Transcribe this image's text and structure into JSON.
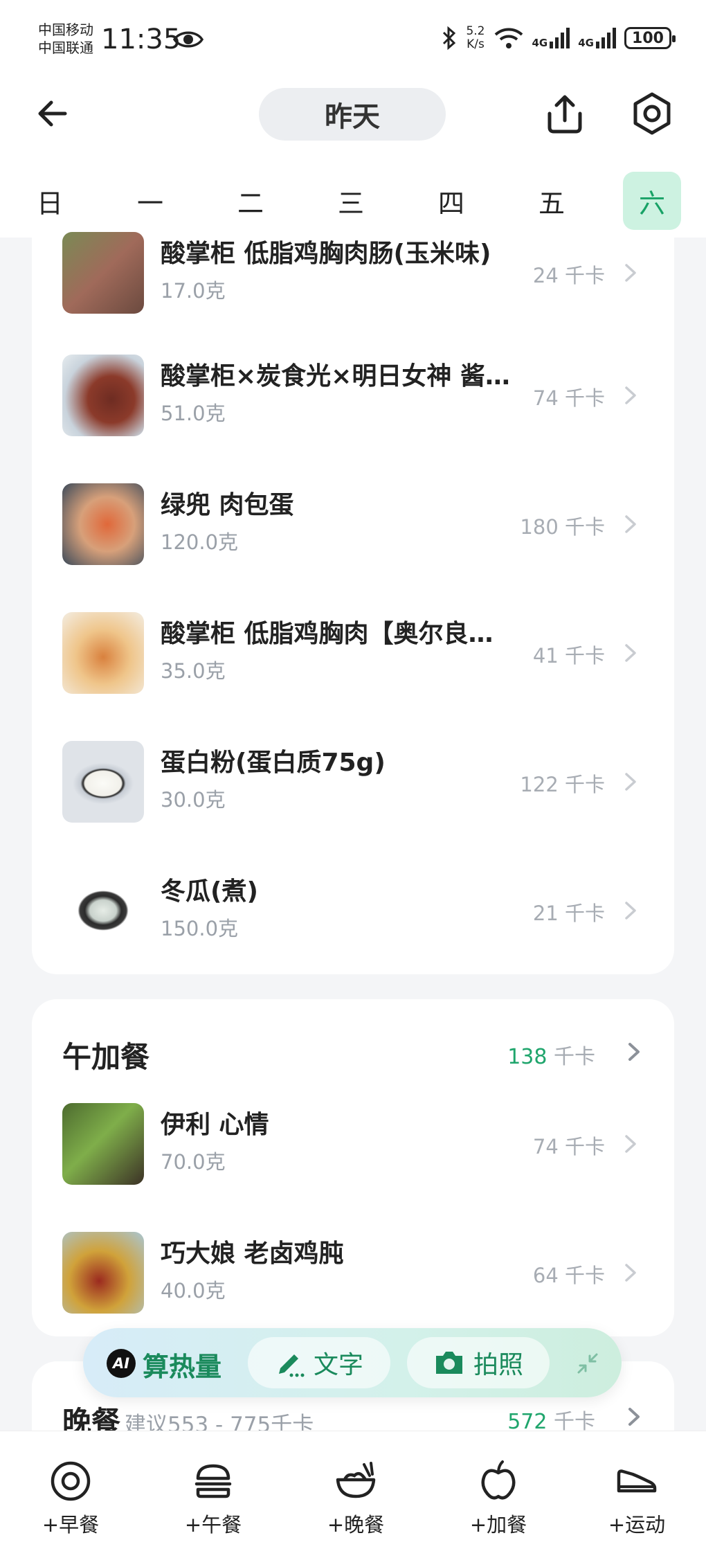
{
  "status_bar": {
    "carrier1": "中国移动",
    "carrier2": "中国联通",
    "time": "11:35",
    "speed_value": "5.2",
    "speed_unit": "K/s",
    "net1": "4G",
    "net2": "4G",
    "battery": "100"
  },
  "header": {
    "day_label": "昨天"
  },
  "weekdays": [
    "日",
    "一",
    "二",
    "三",
    "四",
    "五",
    "六"
  ],
  "active_weekday": "六",
  "lunch_items": [
    {
      "name": "酸掌柜 低脂鸡胸肉肠(玉米味)",
      "weight": "17.0克",
      "cal": "24 千卡"
    },
    {
      "name": "酸掌柜×炭食光×明日女神 酱…",
      "weight": "51.0克",
      "cal": "74 千卡"
    },
    {
      "name": "绿兜 肉包蛋",
      "weight": "120.0克",
      "cal": "180 千卡"
    },
    {
      "name": "酸掌柜 低脂鸡胸肉【奥尔良…",
      "weight": "35.0克",
      "cal": "41 千卡"
    },
    {
      "name": "蛋白粉(蛋白质75g)",
      "weight": "30.0克",
      "cal": "122 千卡"
    },
    {
      "name": "冬瓜(煮)",
      "weight": "150.0克",
      "cal": "21 千卡"
    }
  ],
  "afternoon_snack": {
    "title": "午加餐",
    "total_num": "138",
    "total_unit": "千卡",
    "items": [
      {
        "name": "伊利 心情",
        "weight": "70.0克",
        "cal": "74 千卡"
      },
      {
        "name": "巧大娘 老卤鸡肫",
        "weight": "40.0克",
        "cal": "64 千卡"
      }
    ]
  },
  "dinner": {
    "title": "晚餐",
    "suggestion": "建议553 - 775千卡",
    "total_num": "572",
    "total_unit": "千卡"
  },
  "ai_bar": {
    "badge": "AI",
    "label": "算热量",
    "text_button": "文字",
    "photo_button": "拍照"
  },
  "bottom_nav": [
    "+早餐",
    "+午餐",
    "+晚餐",
    "+加餐",
    "+运动"
  ],
  "colors": {
    "accent_green": "#1fa56c",
    "active_day_bg": "#cdf2e1"
  }
}
